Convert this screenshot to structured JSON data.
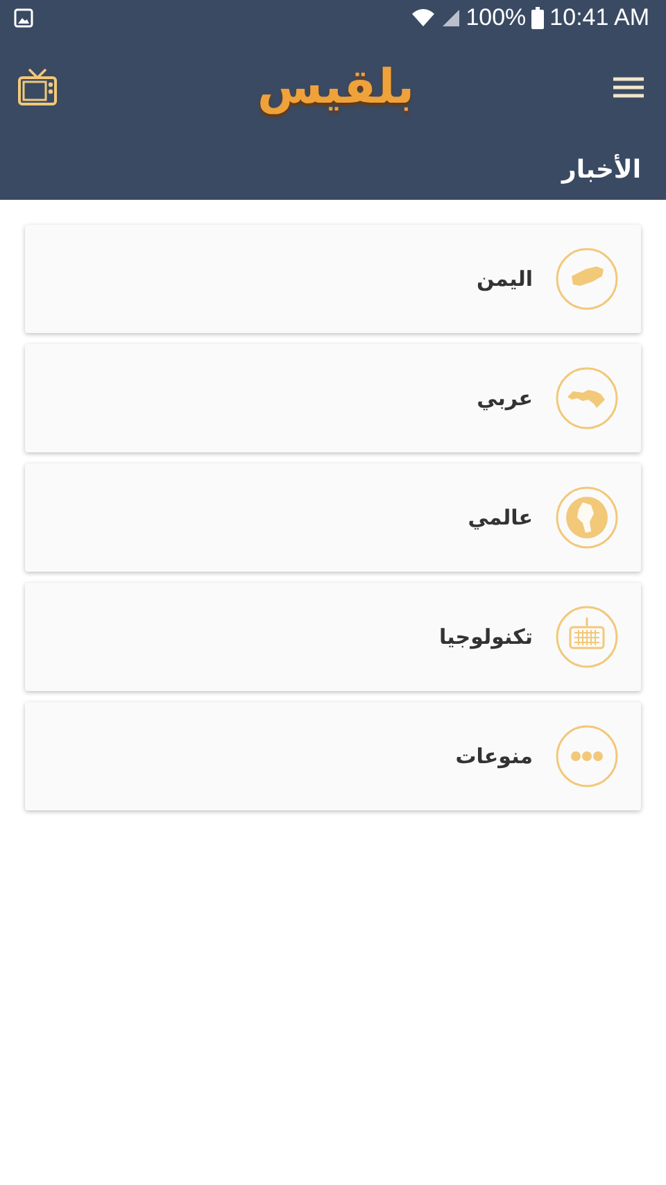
{
  "status_bar": {
    "battery": "100%",
    "time": "10:41 AM"
  },
  "app_bar": {
    "logo": "بلقيس"
  },
  "section_title": "الأخبار",
  "categories": [
    {
      "label": "اليمن",
      "kind": "yemen"
    },
    {
      "label": "عربي",
      "kind": "arab"
    },
    {
      "label": "عالمي",
      "kind": "globe"
    },
    {
      "label": "تكنولوجيا",
      "kind": "keyboard"
    },
    {
      "label": "منوعات",
      "kind": "dots"
    }
  ]
}
